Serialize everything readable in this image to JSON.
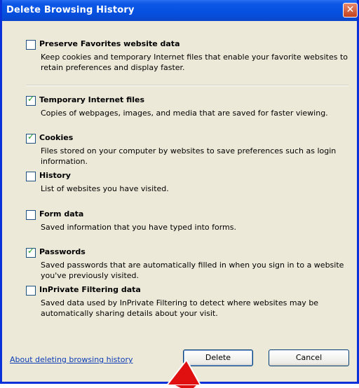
{
  "window": {
    "title": "Delete Browsing History",
    "close_glyph": "✕"
  },
  "options": [
    {
      "title": "Preserve Favorites website data",
      "description": "Keep cookies and temporary Internet files that enable your favorite websites to retain preferences and display faster.",
      "checked": false
    },
    {
      "title": "Temporary Internet files",
      "description": "Copies of webpages, images, and media that are saved for faster viewing.",
      "checked": true
    },
    {
      "title": "Cookies",
      "description": "Files stored on your computer by websites to save preferences such as login information.",
      "checked": true
    },
    {
      "title": "History",
      "description": "List of websites you have visited.",
      "checked": false
    },
    {
      "title": "Form data",
      "description": "Saved information that you have typed into forms.",
      "checked": false
    },
    {
      "title": "Passwords",
      "description": "Saved passwords that are automatically filled in when you sign in to a website you've previously visited.",
      "checked": true
    },
    {
      "title": "InPrivate Filtering data",
      "description": "Saved data used by InPrivate Filtering to detect where websites may be automatically sharing details about your visit.",
      "checked": false
    }
  ],
  "footer": {
    "about_link": "About deleting browsing history",
    "delete_label": "Delete",
    "cancel_label": "Cancel"
  },
  "colors": {
    "titlebar": "#0550e0",
    "check": "#21a121",
    "pointer": "#e01010"
  },
  "check_glyph": "✓"
}
